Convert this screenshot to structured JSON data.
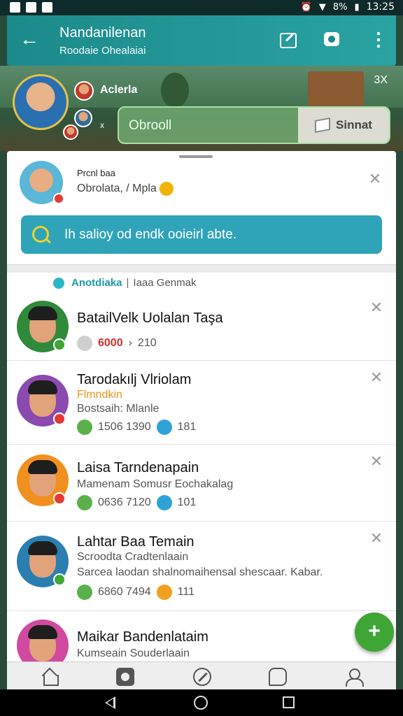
{
  "status_bar": {
    "battery": "8%",
    "time": "13:25"
  },
  "app_bar": {
    "title": "Nandanilenan",
    "subtitle": "Roodaie Ohealaiai"
  },
  "hero": {
    "name": "Aclerla",
    "close_label": "3X",
    "small_label": "x",
    "input_value": "Obrooll",
    "send_label": "Sinnat"
  },
  "notification": {
    "title": "Prcnl baa",
    "text": "Obrolata, / Mpla"
  },
  "search": {
    "placeholder": "Ih salioy od endk ooieirl abte."
  },
  "section": {
    "label": "Anotdiaka",
    "sub": "Iaaa Genmak"
  },
  "contacts": [
    {
      "name": "BatailVelk Uolalan Taşa",
      "line1": "",
      "line2": "",
      "stat1": "6000",
      "stat2": "210",
      "colors": {
        "bg": "#2f8a3a",
        "badge": "#3fa636"
      }
    },
    {
      "name": "Tarodakılj Vlriolam",
      "line1": "Flmndkin",
      "line2": "Bostsaih: Mlanle",
      "stat1": "1506 1390",
      "stat2": "181",
      "colors": {
        "bg": "#8a4ab0",
        "badge": "#e53935"
      }
    },
    {
      "name": "Laisa Tarndenapain",
      "line1": "Mamenam Somusr Eochakalag",
      "line2": "",
      "stat1": "0636 7120",
      "stat2": "101",
      "colors": {
        "bg": "#f0901e",
        "badge": "#e53935"
      }
    },
    {
      "name": "Lahtar Baa Temain",
      "line1": "Scroodta Cradtenlaain",
      "line2": "Sarcea laodan shalnomaihensal shescaar. Kabar.",
      "stat1": "6860 7494",
      "stat2": "111",
      "colors": {
        "bg": "#2a7fb0",
        "badge": "#3fa636"
      }
    },
    {
      "name": "Maikar Bandenlataim",
      "line1": "Kumseain Souderlaain",
      "line2": "",
      "stat1": "",
      "stat2": "",
      "colors": {
        "bg": "#d04aa0",
        "badge": "#3fa636"
      }
    }
  ],
  "fab": {
    "label": "+"
  },
  "icons": {
    "back": "arrow-left-icon",
    "edit": "edit-icon",
    "camera": "camera-icon",
    "more": "more-vertical-icon",
    "search": "search-icon"
  },
  "accent": "#1b8a8a"
}
